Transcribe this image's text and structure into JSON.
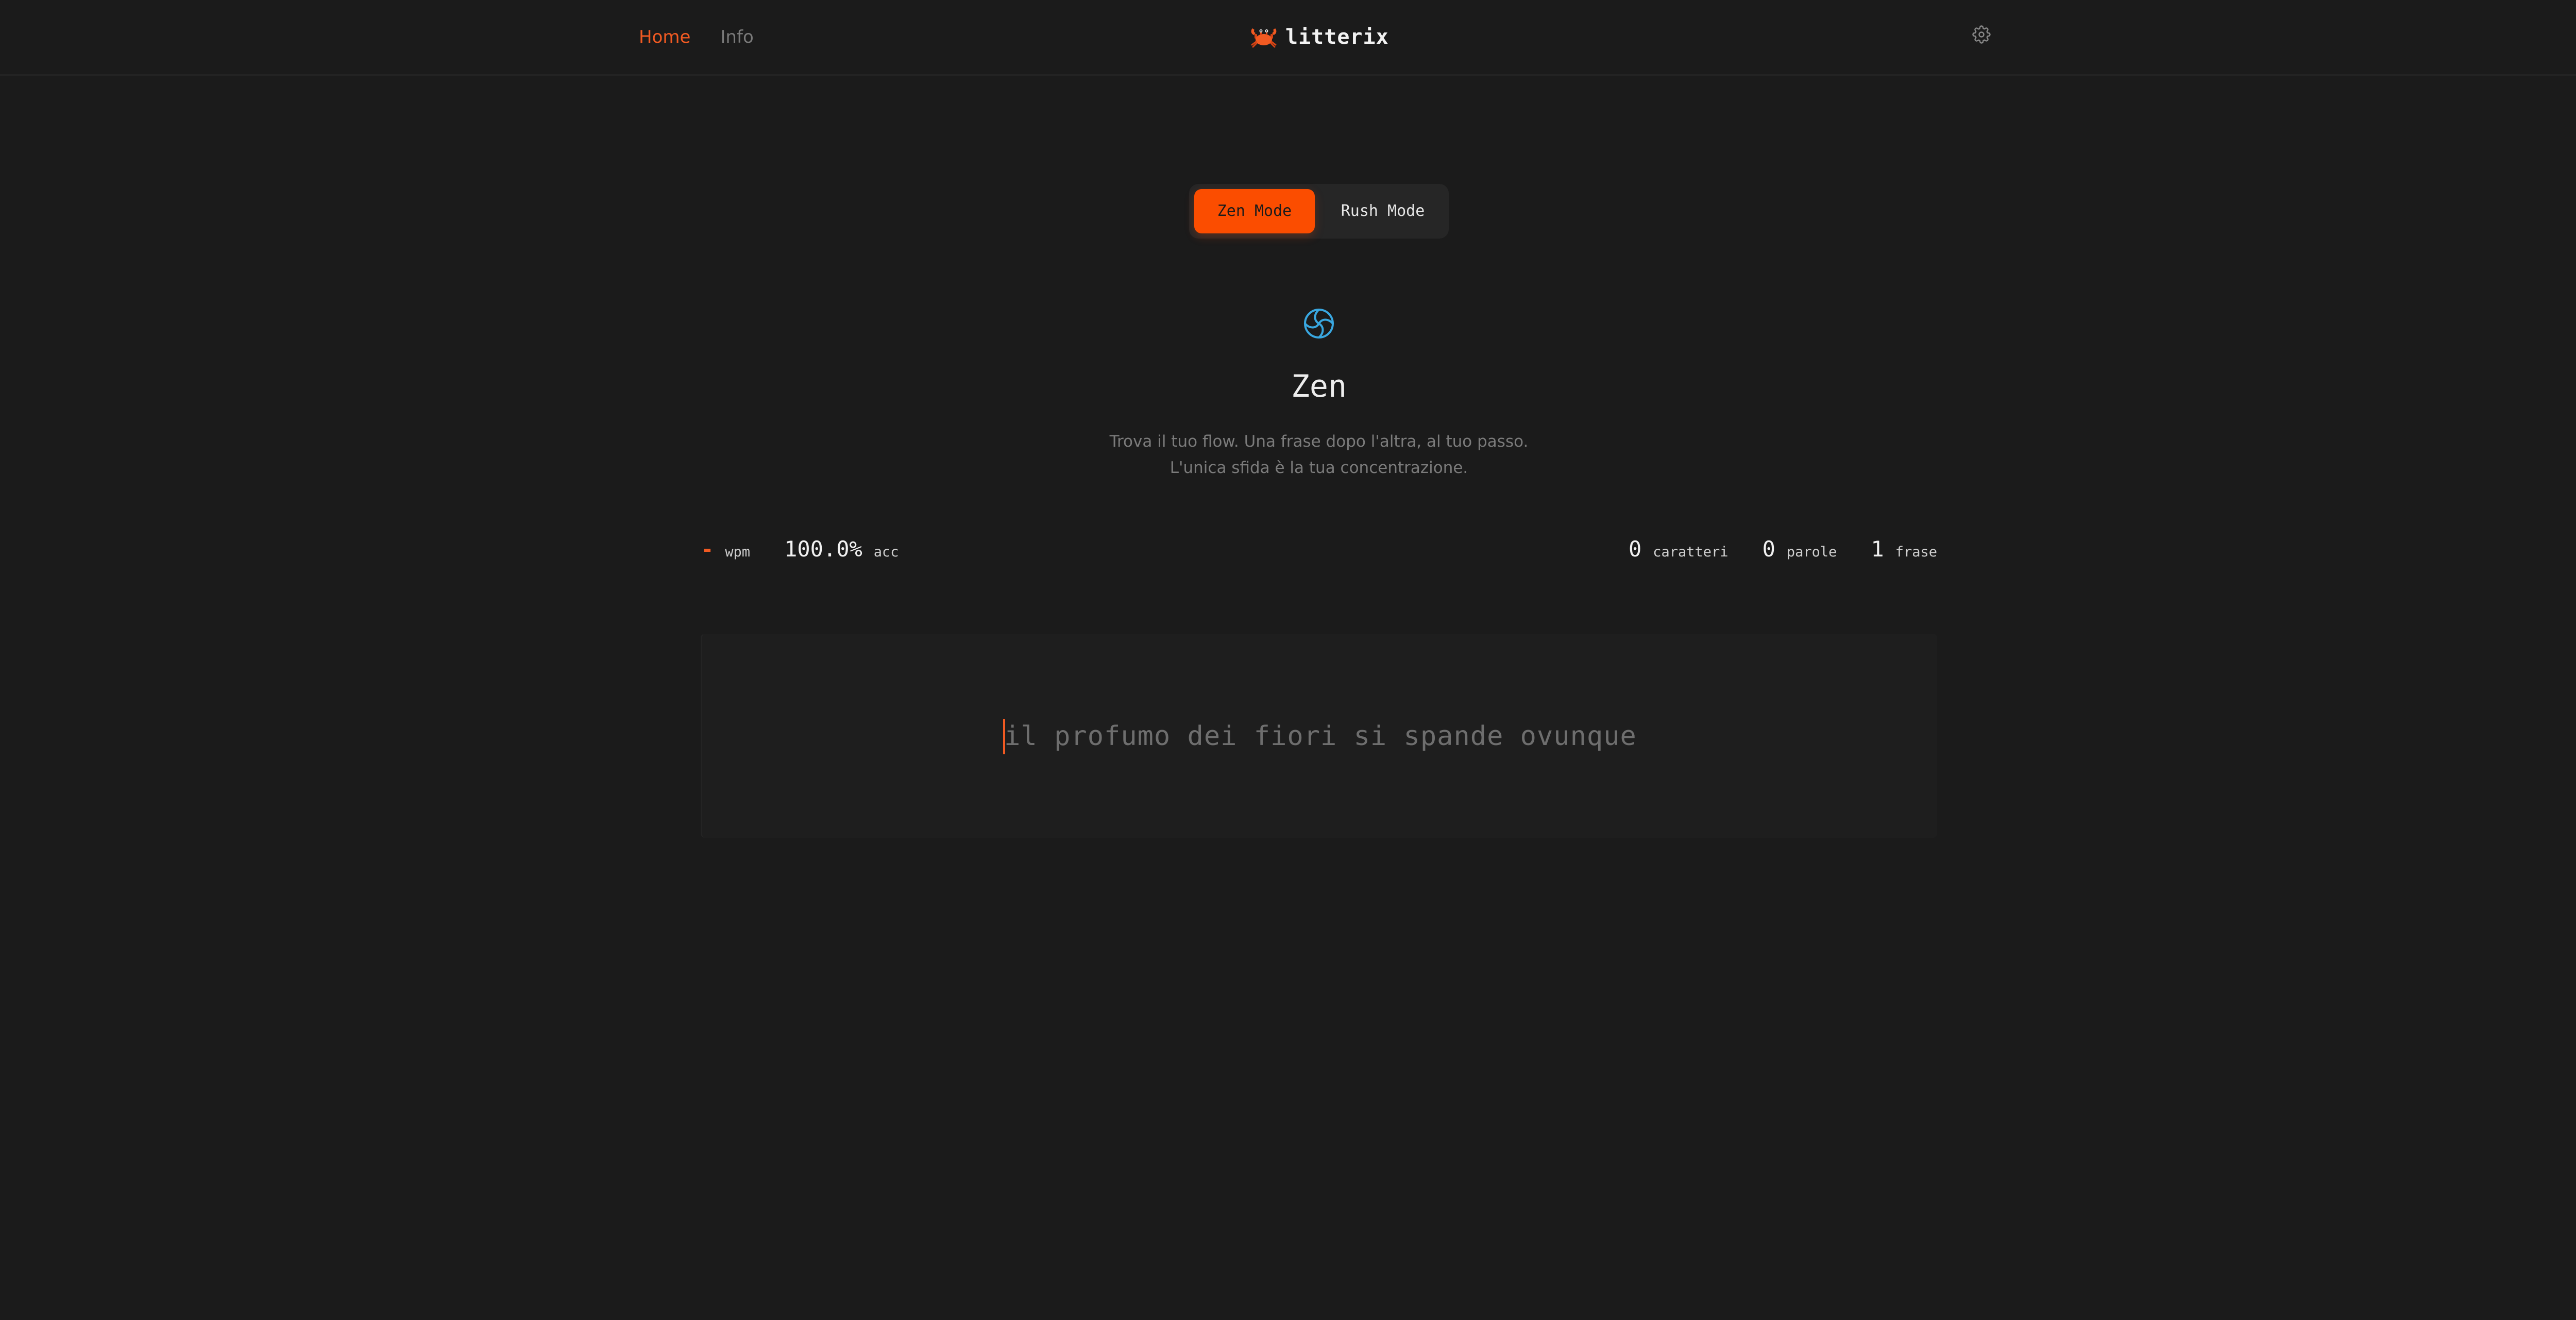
{
  "nav": {
    "home_label": "Home",
    "info_label": "Info"
  },
  "brand": {
    "name": "litterix",
    "logo_icon": "crab-icon"
  },
  "settings": {
    "icon": "gear-icon"
  },
  "mode_toggle": {
    "zen_label": "Zen Mode",
    "rush_label": "Rush Mode",
    "selected": "Zen Mode"
  },
  "mode_info": {
    "icon": "swirl-icon",
    "title": "Zen",
    "description": "Trova il tuo flow. Una frase dopo l'altra, al tuo passo. L'unica sfida è la tua concentrazione."
  },
  "stats": {
    "wpm_value": "-",
    "wpm_unit": "wpm",
    "acc_value": "100.0%",
    "acc_unit": "acc",
    "chars_value": "0",
    "chars_unit": "caratteri",
    "words_value": "0",
    "words_unit": "parole",
    "sentences_value": "1",
    "sentences_unit": "frase"
  },
  "typing": {
    "sentence": "il profumo dei fiori si spande ovunque"
  },
  "colors": {
    "background": "#1b1b1b",
    "accent": "#fb4d00",
    "zen_icon": "#39a7e0",
    "muted_text": "#7b7b7b"
  }
}
